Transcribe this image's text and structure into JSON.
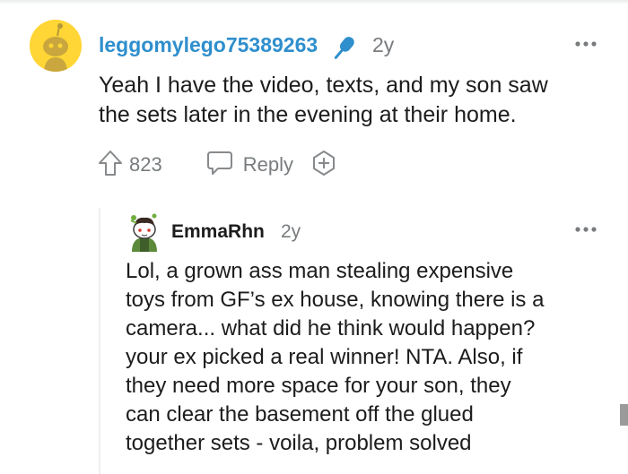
{
  "comment": {
    "username": "leggomylego75389263",
    "user_flair_icon": "microphone-icon",
    "age": "2y",
    "more_icon": "more-options-icon",
    "body_lines": [
      "Yeah I have the video, texts, and my son saw",
      "the sets later in the evening at their home."
    ],
    "actions": {
      "upvote_icon": "upvote-arrow-icon",
      "vote_count": "823",
      "reply_icon": "speech-bubble-icon",
      "reply_label": "Reply",
      "award_icon": "add-award-icon"
    }
  },
  "reply": {
    "username": "EmmaRhn",
    "age": "2y",
    "more_icon": "more-options-icon",
    "body_lines": [
      "Lol, a grown ass man stealing expensive",
      "toys from GF’s ex house, knowing there is a",
      "camera... what did he think would happen?",
      "your ex picked a real winner! NTA. Also, if",
      "they need more space for your son, they",
      "can clear the basement off the glued",
      "together sets - voila, problem solved"
    ]
  },
  "colors": {
    "username_link": "#2f8fcd",
    "muted": "#787c7e",
    "avatar_bg": "#ffd635",
    "text": "#1c1c1c"
  }
}
